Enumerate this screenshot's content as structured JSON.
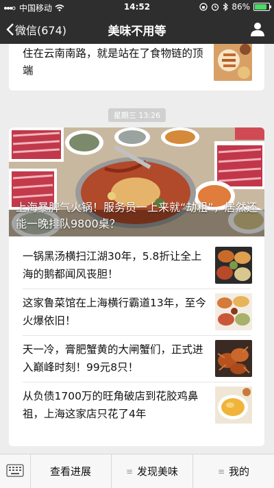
{
  "status_bar": {
    "carrier": "中国移动",
    "time": "14:52",
    "battery": "86%",
    "battery_level": 0.86,
    "icons": [
      "signal-icon",
      "wifi-icon",
      "lock-rotation-icon",
      "alarm-icon",
      "bluetooth-icon",
      "battery-icon"
    ]
  },
  "nav": {
    "back_label": "微信(674)",
    "title": "美味不用等",
    "right_icon": "person-icon"
  },
  "messages": {
    "top_card": {
      "text": "住在云南南路，就是站在了食物链的顶端"
    },
    "timestamp": "星期三 13:26",
    "article": {
      "headline": "上海暴脾气火锅！服务员一上来就“劫粗”，居然还能一晚排队9800桌？",
      "items": [
        {
          "title": "一锅黑汤横扫江湖30年，5.8折让全上海的鹅都闻风丧胆！"
        },
        {
          "title": "这家鲁菜馆在上海横行霸道13年，至今火爆依旧！"
        },
        {
          "title": "天一冷，膏肥蟹黄的大闸蟹们，正式进入巅峰时刻！99元8只！"
        },
        {
          "title": "从负债1700万的旺角破店到花胶鸡鼻祖，上海这家店只花了4年"
        }
      ]
    }
  },
  "tabbar": {
    "keyboard_icon": "keyboard-icon",
    "tabs": [
      {
        "label": "查看进展"
      },
      {
        "label": "发现美味"
      },
      {
        "label": "我的"
      }
    ]
  },
  "colors": {
    "header_bg": "#2e2e2e",
    "page_bg": "#ededed",
    "battery_green": "#4cd964"
  }
}
